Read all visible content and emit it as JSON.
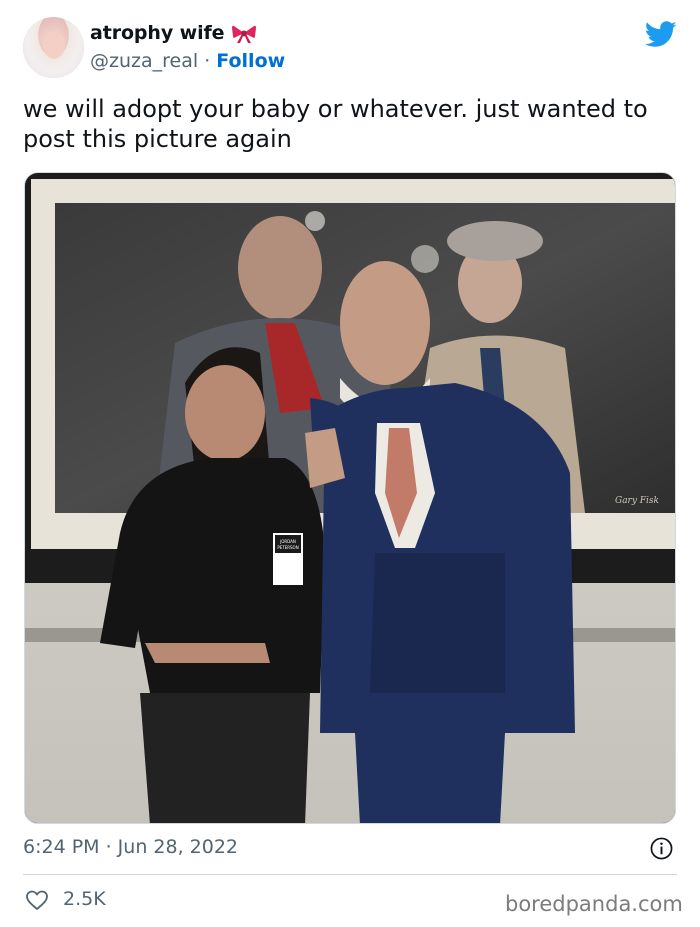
{
  "author": {
    "display_name": "atrophy wife",
    "handle": "@zuza_real",
    "separator": "·",
    "follow_label": "Follow"
  },
  "tweet": {
    "text": "we will adopt your baby or whatever. just wanted to post this picture again",
    "timestamp": "6:24 PM · Jun 28, 2022",
    "like_count": "2.5K"
  },
  "photo": {
    "badge_lines": [
      "JORDAN",
      "PETERSON"
    ],
    "painting_signature": "Gary Fisk"
  },
  "watermark": "boredpanda.com",
  "colors": {
    "twitter_blue": "#1d9bf0",
    "follow_blue": "#006fd6",
    "secondary_text": "#536471",
    "bow_red": "#e0245e"
  },
  "icons": {
    "bow": "red-bow-emoji",
    "brand": "twitter-bird",
    "info": "info-circle",
    "like": "heart-outline"
  }
}
